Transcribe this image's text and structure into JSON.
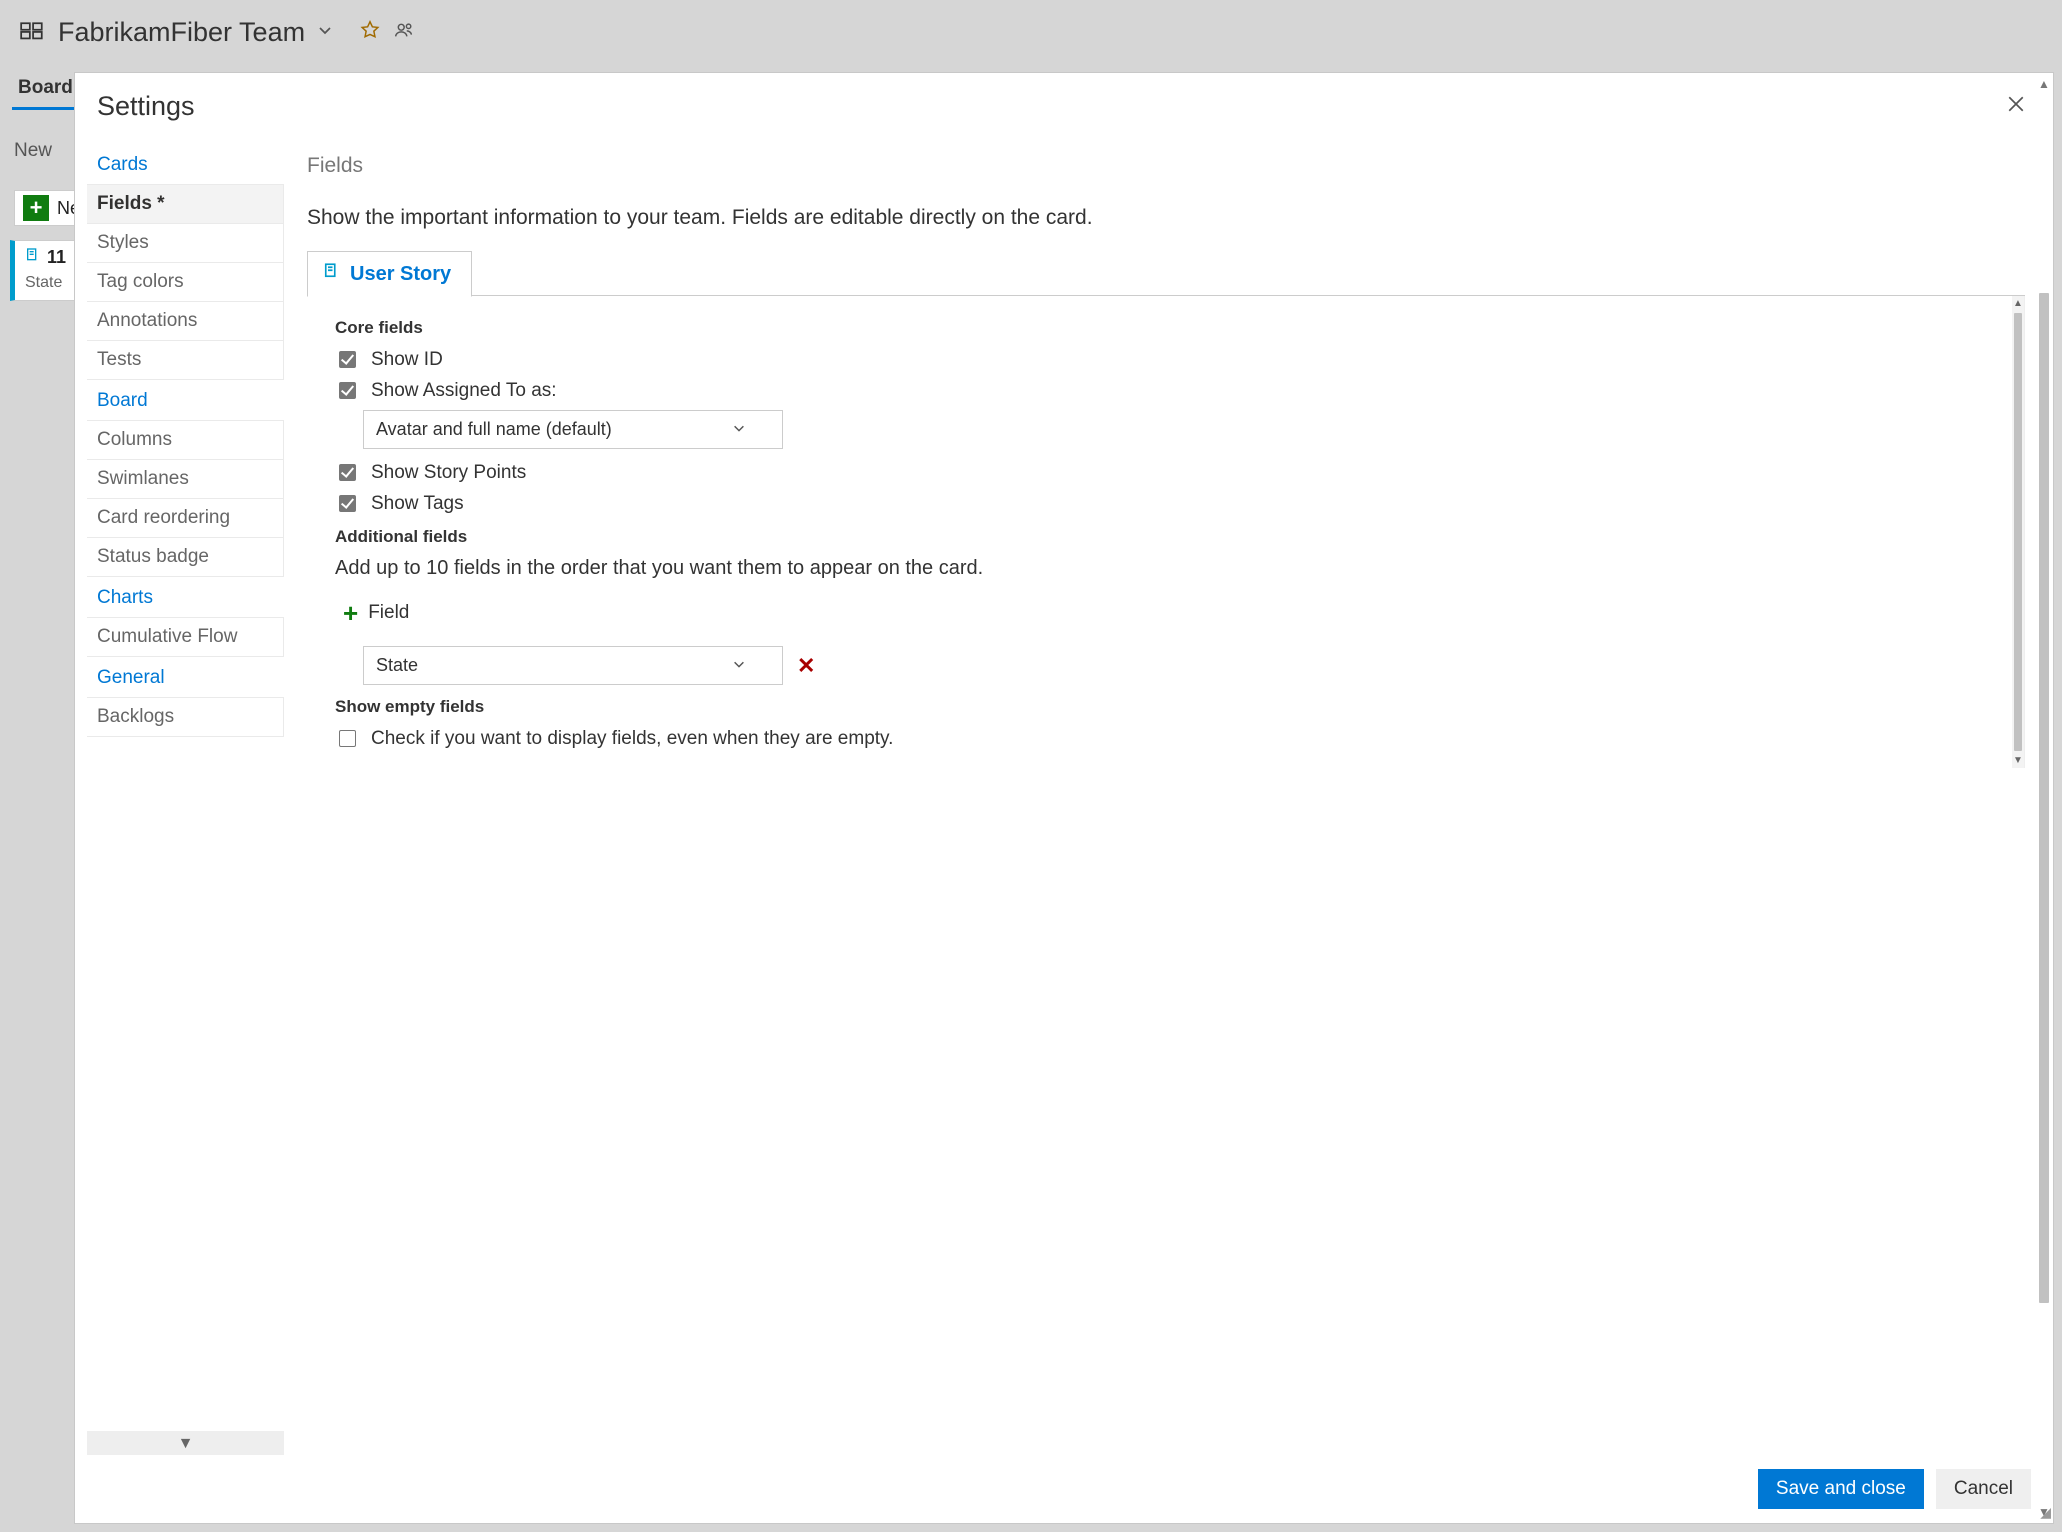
{
  "background": {
    "team_name": "FabrikamFiber Team",
    "tab_board": "Board",
    "column_new": "New",
    "new_item": "Ne",
    "card_id": "11",
    "card_state_label": "State"
  },
  "modal": {
    "title": "Settings",
    "close_label": "Close"
  },
  "nav": {
    "groups": [
      {
        "label": "Cards",
        "items": [
          {
            "label": "Fields *",
            "active": true
          },
          {
            "label": "Styles"
          },
          {
            "label": "Tag colors"
          },
          {
            "label": "Annotations"
          },
          {
            "label": "Tests"
          }
        ]
      },
      {
        "label": "Board",
        "items": [
          {
            "label": "Columns"
          },
          {
            "label": "Swimlanes"
          },
          {
            "label": "Card reordering"
          },
          {
            "label": "Status badge"
          }
        ]
      },
      {
        "label": "Charts",
        "items": [
          {
            "label": "Cumulative Flow"
          }
        ]
      },
      {
        "label": "General",
        "items": [
          {
            "label": "Backlogs"
          }
        ]
      }
    ]
  },
  "main": {
    "heading": "Fields",
    "description": "Show the important information to your team. Fields are editable directly on the card.",
    "tab_label": "User Story",
    "core_fields_heading": "Core fields",
    "show_id_label": "Show ID",
    "show_assigned_label": "Show Assigned To as:",
    "assigned_dropdown_value": "Avatar and full name (default)",
    "show_story_points_label": "Show Story Points",
    "show_tags_label": "Show Tags",
    "additional_fields_heading": "Additional fields",
    "additional_fields_desc": "Add up to 10 fields in the order that you want them to appear on the card.",
    "add_field_label": "Field",
    "field_dropdown_value": "State",
    "show_empty_heading": "Show empty fields",
    "show_empty_check_label": "Check if you want to display fields, even when they are empty."
  },
  "footer": {
    "save_label": "Save and close",
    "cancel_label": "Cancel"
  }
}
